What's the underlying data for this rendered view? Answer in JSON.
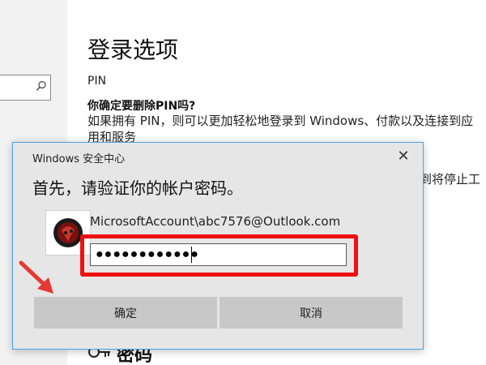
{
  "settings": {
    "page_title": "登录选项",
    "section_label": "PIN",
    "confirm_heading": "你确定要删除PIN吗?",
    "description": "如果拥有 PIN，则可以更加轻松地登录到 Windows、付款以及连接到应\n用和服务",
    "description_right_fragment": "到将停止工",
    "sign_in_fragment": "密码"
  },
  "dialog": {
    "title": "Windows 安全中心",
    "heading": "首先，请验证你的帐户密码。",
    "account": "MicrosoftAccount\\abc7576@Outlook.com",
    "password_value": "●●●●●●●●●●●●",
    "ok_label": "确定",
    "cancel_label": "取消",
    "close_glyph": "✕"
  },
  "colors": {
    "highlight": "#ee1111",
    "arrow": "#e53935",
    "dialog_border": "#4aa3e8"
  },
  "icons": {
    "search": "search-icon",
    "close": "close-icon",
    "avatar": "avatar-image",
    "key": "key-icon",
    "arrow": "pointer-arrow"
  }
}
